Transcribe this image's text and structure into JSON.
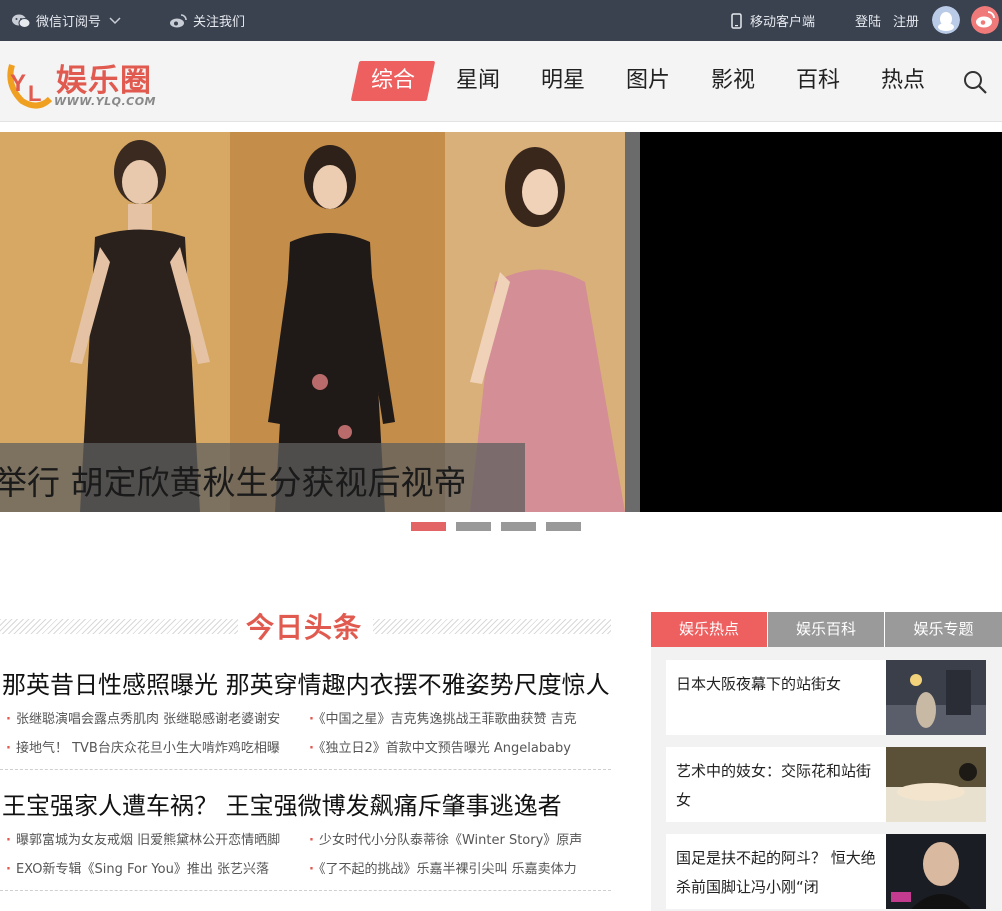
{
  "topbar": {
    "wechat_label": "微信订阅号",
    "follow_label": "关注我们",
    "mobile_label": "移动客户端",
    "login_label": "登陆",
    "register_label": "注册"
  },
  "logo": {
    "name": "娱乐圈",
    "url": "WWW.YLQ.COM"
  },
  "nav": {
    "items": [
      "综合",
      "星闻",
      "明星",
      "图片",
      "影视",
      "百科",
      "热点"
    ],
    "active_index": 0
  },
  "hero": {
    "caption": "举行 胡定欣黄秋生分获视后视帝",
    "dots_count": 4,
    "active_dot": 0
  },
  "today": {
    "title": "今日头条",
    "groups": [
      {
        "headline": "那英昔日性感照曝光 那英穿情趣内衣摆不雅姿势尺度惊人",
        "subs": [
          "张继聪演唱会露点秀肌肉 张继聪感谢老婆谢安",
          "《中国之星》吉克隽逸挑战王菲歌曲获赞 吉克",
          "接地气！ TVB台庆众花旦小生大啃炸鸡吃相曝",
          "《独立日2》首款中文预告曝光 Angelababy"
        ]
      },
      {
        "headline": "王宝强家人遭车祸？ 王宝强微博发飙痛斥肇事逃逸者",
        "subs": [
          "曝郭富城为女友戒烟 旧爱熊黛林公开恋情晒脚",
          "少女时代小分队泰蒂徐《Winter Story》原声",
          "EXO新专辑《Sing For You》推出 张艺兴落",
          "《了不起的挑战》乐嘉半裸引尖叫 乐嘉卖体力"
        ]
      }
    ]
  },
  "side": {
    "tabs": [
      "娱乐热点",
      "娱乐百科",
      "娱乐专题"
    ],
    "active_tab": 0,
    "items": [
      {
        "text": "日本大阪夜幕下的站街女"
      },
      {
        "text": "艺术中的妓女：交际花和站街女"
      },
      {
        "text": "国足是扶不起的阿斗？ 恒大绝杀前国脚让冯小刚“闭"
      }
    ]
  },
  "colors": {
    "accent": "#ee5f5f",
    "topbar": "#3a4250",
    "tab_inactive": "#9a9a9a"
  }
}
